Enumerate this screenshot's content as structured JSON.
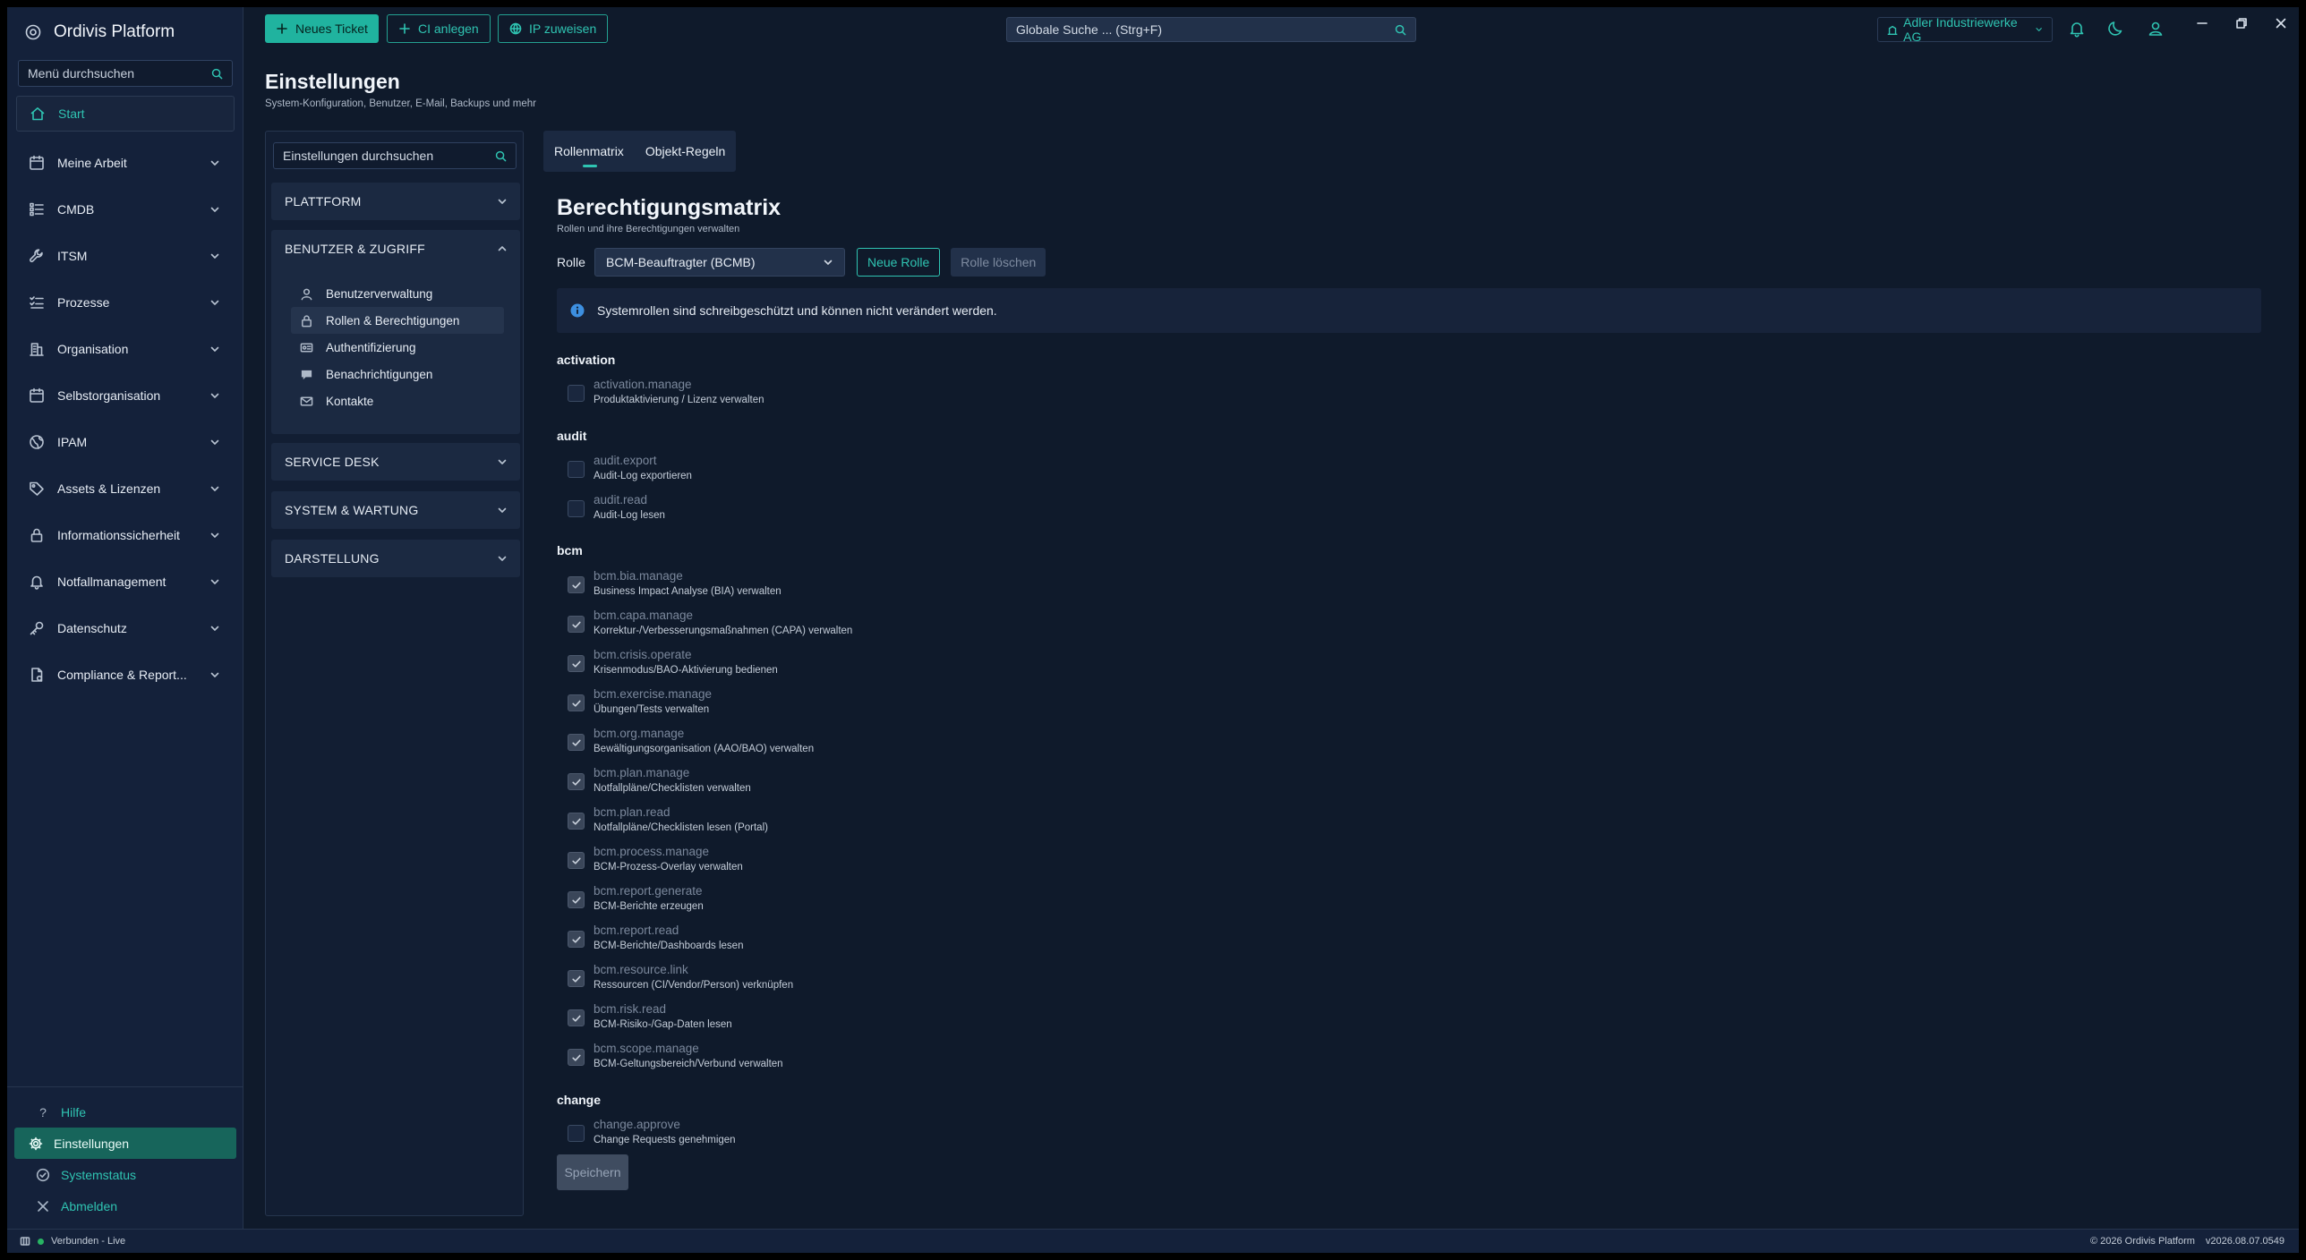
{
  "app": {
    "title": "Ordivis Platform"
  },
  "sidebar": {
    "search_placeholder": "Menü durchsuchen",
    "start_label": "Start",
    "items": [
      {
        "label": "Meine Arbeit",
        "icon": "calendar-icon"
      },
      {
        "label": "CMDB",
        "icon": "list-icon"
      },
      {
        "label": "ITSM",
        "icon": "wrench-icon"
      },
      {
        "label": "Prozesse",
        "icon": "process-list-icon"
      },
      {
        "label": "Organisation",
        "icon": "building-icon"
      },
      {
        "label": "Selbstorganisation",
        "icon": "calendar-icon"
      },
      {
        "label": "IPAM",
        "icon": "globe-icon"
      },
      {
        "label": "Assets & Lizenzen",
        "icon": "tag-icon"
      },
      {
        "label": "Informationssicherheit",
        "icon": "lock-icon"
      },
      {
        "label": "Notfallmanagement",
        "icon": "bell-icon"
      },
      {
        "label": "Datenschutz",
        "icon": "key-icon"
      },
      {
        "label": "Compliance & Report...",
        "icon": "document-icon"
      }
    ],
    "bottom": {
      "help": "Hilfe",
      "settings": "Einstellungen",
      "status": "Systemstatus",
      "logout": "Abmelden"
    }
  },
  "toolbar": {
    "new_ticket": "Neues Ticket",
    "create_ci": "CI anlegen",
    "assign_ip": "IP zuweisen",
    "search_placeholder": "Globale Suche ... (Strg+F)",
    "tenant": "Adler Industriewerke AG"
  },
  "page": {
    "title": "Einstellungen",
    "subtitle": "System-Konfiguration, Benutzer, E-Mail, Backups und mehr"
  },
  "settings_nav": {
    "search_placeholder": "Einstellungen durchsuchen",
    "sections": {
      "platform": "PLATTFORM",
      "users": "BENUTZER & ZUGRIFF",
      "servicedesk": "SERVICE DESK",
      "system": "SYSTEM & WARTUNG",
      "display": "DARSTELLUNG"
    },
    "user_items": {
      "users": "Benutzerverwaltung",
      "roles": "Rollen & Berechtigungen",
      "auth": "Authentifizierung",
      "notifications": "Benachrichtigungen",
      "contacts": "Kontakte"
    }
  },
  "tabs": {
    "matrix": "Rollenmatrix",
    "object_rules": "Objekt-Regeln"
  },
  "matrix": {
    "title": "Berechtigungsmatrix",
    "subtitle": "Rollen und ihre Berechtigungen verwalten",
    "role_label": "Rolle",
    "role_value": "BCM-Beauftragter (BCMB)",
    "new_role": "Neue Rolle",
    "delete_role": "Rolle löschen",
    "info": "Systemrollen sind schreibgeschützt und können nicht verändert werden.",
    "save": "Speichern",
    "groups": {
      "activation": "activation",
      "audit": "audit",
      "bcm": "bcm",
      "change": "change"
    },
    "perms": {
      "p0": {
        "key": "activation.manage",
        "desc": "Produktaktivierung / Lizenz verwalten"
      },
      "p1": {
        "key": "audit.export",
        "desc": "Audit-Log exportieren"
      },
      "p2": {
        "key": "audit.read",
        "desc": "Audit-Log lesen"
      },
      "p3": {
        "key": "bcm.bia.manage",
        "desc": "Business Impact Analyse (BIA) verwalten"
      },
      "p4": {
        "key": "bcm.capa.manage",
        "desc": "Korrektur-/Verbesserungsmaßnahmen (CAPA) verwalten"
      },
      "p5": {
        "key": "bcm.crisis.operate",
        "desc": "Krisenmodus/BAO-Aktivierung bedienen"
      },
      "p6": {
        "key": "bcm.exercise.manage",
        "desc": "Übungen/Tests verwalten"
      },
      "p7": {
        "key": "bcm.org.manage",
        "desc": "Bewältigungsorganisation (AAO/BAO) verwalten"
      },
      "p8": {
        "key": "bcm.plan.manage",
        "desc": "Notfallpläne/Checklisten verwalten"
      },
      "p9": {
        "key": "bcm.plan.read",
        "desc": "Notfallpläne/Checklisten lesen (Portal)"
      },
      "p10": {
        "key": "bcm.process.manage",
        "desc": "BCM-Prozess-Overlay verwalten"
      },
      "p11": {
        "key": "bcm.report.generate",
        "desc": "BCM-Berichte erzeugen"
      },
      "p12": {
        "key": "bcm.report.read",
        "desc": "BCM-Berichte/Dashboards lesen"
      },
      "p13": {
        "key": "bcm.resource.link",
        "desc": "Ressourcen (CI/Vendor/Person) verknüpfen"
      },
      "p14": {
        "key": "bcm.risk.read",
        "desc": "BCM-Risiko-/Gap-Daten lesen"
      },
      "p15": {
        "key": "bcm.scope.manage",
        "desc": "BCM-Geltungsbereich/Verbund verwalten"
      },
      "p16": {
        "key": "change.approve",
        "desc": "Change Requests genehmigen"
      }
    }
  },
  "statusbar": {
    "connection": "Verbunden - Live",
    "copyright": "© 2026 Ordivis Platform",
    "version": "v2026.08.07.0549"
  },
  "colors": {
    "accent": "#2fc4b2",
    "background": "#0f1a2b",
    "sidebar": "#14213a",
    "active_nav": "#17655b"
  }
}
